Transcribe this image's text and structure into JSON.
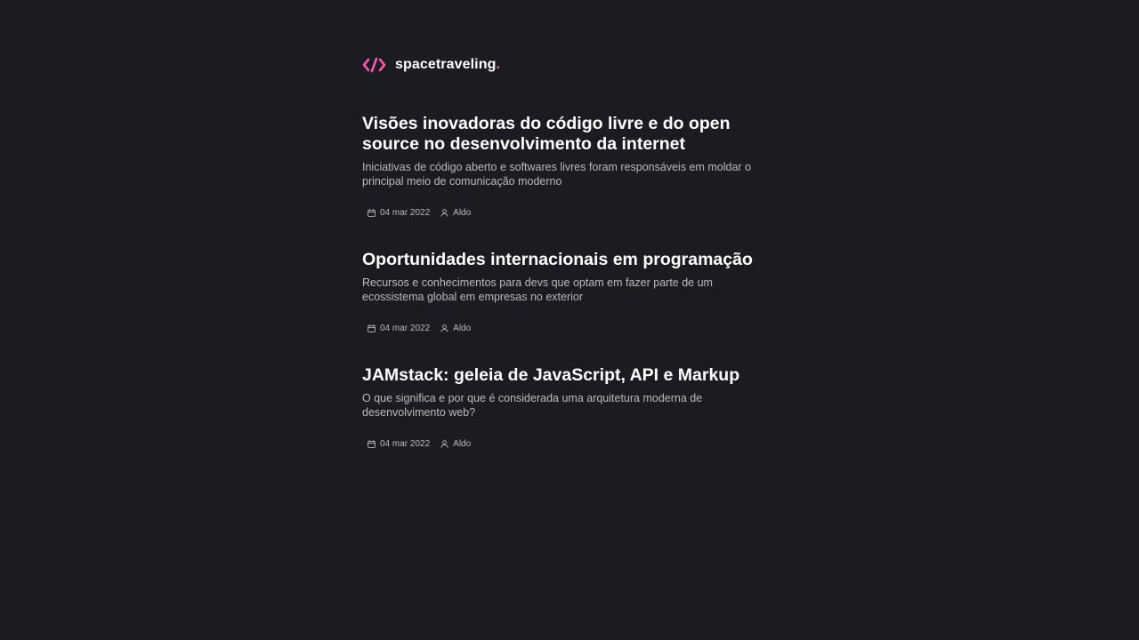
{
  "header": {
    "logo_text": "spacetraveling",
    "logo_dot": ".",
    "logo_icon": "code-brackets-icon",
    "accent_color": "#ff57b2"
  },
  "posts": [
    {
      "title": "Visões inovadoras do código livre e do open source no desenvolvimento da internet",
      "subtitle": "Iniciativas de código aberto e softwares livres foram responsáveis em moldar o principal meio de comunicação moderno",
      "date": "04 mar 2022",
      "author": "Aldo"
    },
    {
      "title": "Oportunidades internacionais em programação",
      "subtitle": "Recursos e conhecimentos para devs que optam em fazer parte de um ecossistema global em empresas no exterior",
      "date": "04 mar 2022",
      "author": "Aldo"
    },
    {
      "title": "JAMstack: geleia de JavaScript, API e Markup",
      "subtitle": "O que significa e por que é considerada uma arquitetura moderna de desenvolvimento web?",
      "date": "04 mar 2022",
      "author": "Aldo"
    }
  ],
  "icons": {
    "date": "calendar-icon",
    "author": "user-icon"
  },
  "colors": {
    "background": "#1b1c22",
    "title": "#ffffff",
    "body": "#bbbbbb"
  }
}
